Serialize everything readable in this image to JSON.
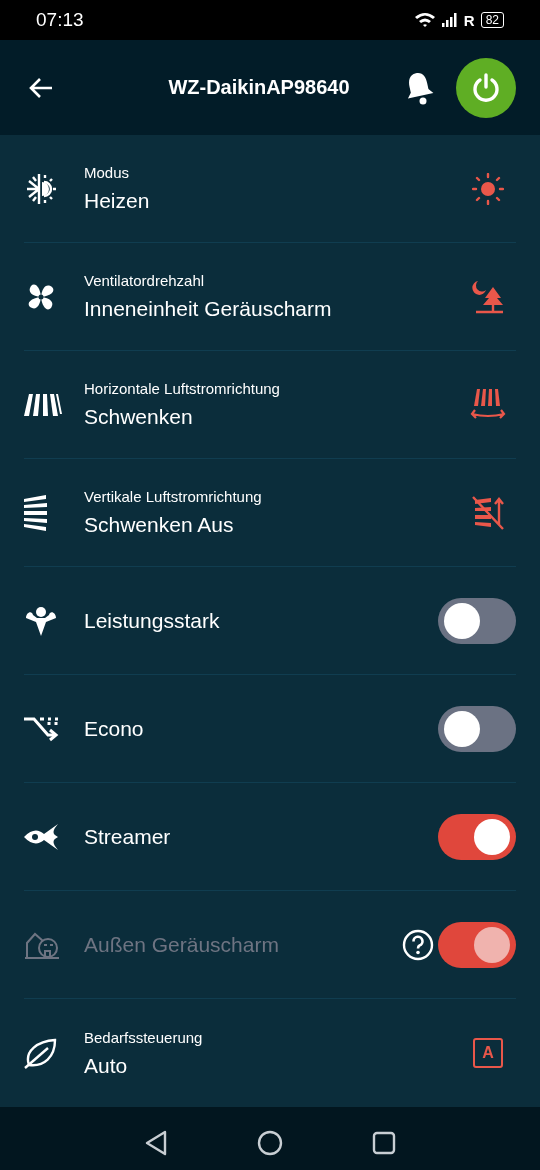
{
  "status_bar": {
    "time": "07:13",
    "roaming": "R",
    "battery": "82"
  },
  "header": {
    "title": "WZ-DaikinAP98640",
    "power_on": true
  },
  "rows": [
    {
      "kind": "select",
      "label": "Modus",
      "value": "Heizen"
    },
    {
      "kind": "select",
      "label": "Ventilatordrehzahl",
      "value": "Inneneinheit Geräuscharm"
    },
    {
      "kind": "select",
      "label": "Horizontale Luftstromrichtung",
      "value": "Schwenken"
    },
    {
      "kind": "select",
      "label": "Vertikale Luftstromrichtung",
      "value": "Schwenken Aus"
    },
    {
      "kind": "toggle",
      "label": "Leistungsstark",
      "on": false,
      "disabled": false,
      "help": false
    },
    {
      "kind": "toggle",
      "label": "Econo",
      "on": false,
      "disabled": false,
      "help": false
    },
    {
      "kind": "toggle",
      "label": "Streamer",
      "on": true,
      "disabled": false,
      "help": false
    },
    {
      "kind": "toggle",
      "label": "Außen Geräuscharm",
      "on": true,
      "disabled": true,
      "help": true
    },
    {
      "kind": "select",
      "label": "Bedarfssteuerung",
      "value": "Auto",
      "value_icon_letter": "A"
    }
  ]
}
